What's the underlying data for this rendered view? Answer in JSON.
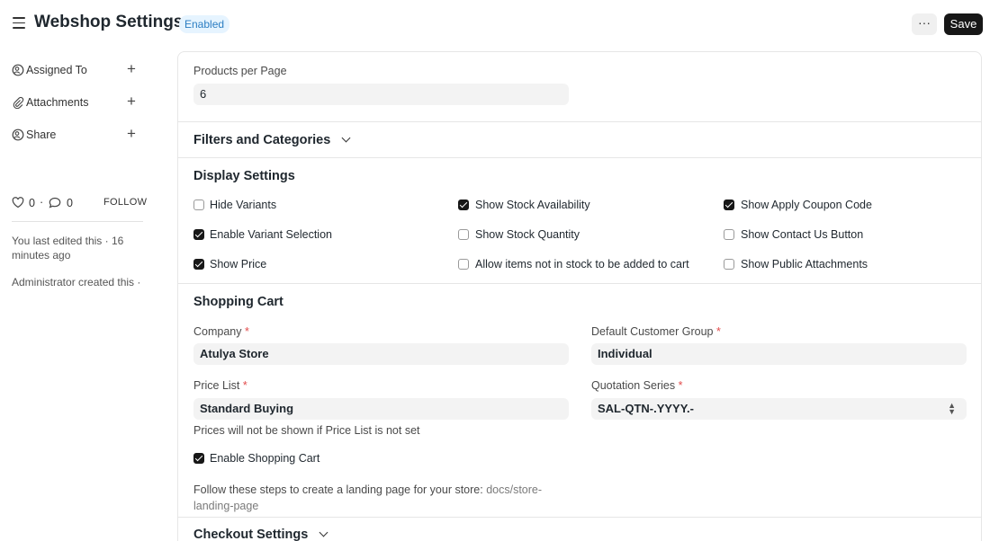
{
  "header": {
    "title": "Webshop Settings",
    "status": "Enabled",
    "more_label": "···",
    "save_label": "Save"
  },
  "sidebar": {
    "assigned_to": "Assigned To",
    "attachments": "Attachments",
    "share": "Share",
    "plus": "+",
    "likes": "0",
    "comments": "0",
    "dot": "·",
    "follow": "FOLLOW",
    "last_edited": "You last edited this · 16 minutes ago",
    "created": "Administrator created this ·"
  },
  "products": {
    "label": "Products per Page",
    "value": "6"
  },
  "filters": {
    "title": "Filters and Categories"
  },
  "display": {
    "title": "Display Settings",
    "checkboxes": [
      {
        "label": "Hide Variants",
        "checked": false
      },
      {
        "label": "Enable Variant Selection",
        "checked": true
      },
      {
        "label": "Show Price",
        "checked": true
      },
      {
        "label": "Show Stock Availability",
        "checked": true
      },
      {
        "label": "Show Stock Quantity",
        "checked": false
      },
      {
        "label": "Allow items not in stock to be added to cart",
        "checked": false
      },
      {
        "label": "Show Apply Coupon Code",
        "checked": true
      },
      {
        "label": "Show Contact Us Button",
        "checked": false
      },
      {
        "label": "Show Public Attachments",
        "checked": false
      }
    ]
  },
  "cart": {
    "title": "Shopping Cart",
    "company_label": "Company",
    "company_value": "Atulya Store",
    "customer_group_label": "Default Customer Group",
    "customer_group_value": "Individual",
    "price_list_label": "Price List",
    "price_list_value": "Standard Buying",
    "price_list_help": "Prices will not be shown if Price List is not set",
    "quotation_label": "Quotation Series",
    "quotation_value": "SAL-QTN-.YYYY.-",
    "required_mark": "*",
    "enable_cart_label": "Enable Shopping Cart",
    "enable_cart_checked": true,
    "steps_text": "Follow these steps to create a landing page for your store:",
    "steps_link": "docs/store-landing-page"
  },
  "checkout": {
    "title": "Checkout Settings"
  },
  "colors": {
    "primary": "#171717",
    "badge_bg": "#e6f4ff",
    "badge_text": "#2c7ec2",
    "required": "#e24c4c"
  },
  "icons": [
    "menu-icon",
    "assign-icon",
    "paperclip-icon",
    "share-icon",
    "heart-icon",
    "comment-icon",
    "chevron-down-icon",
    "select-arrows-icon"
  ]
}
